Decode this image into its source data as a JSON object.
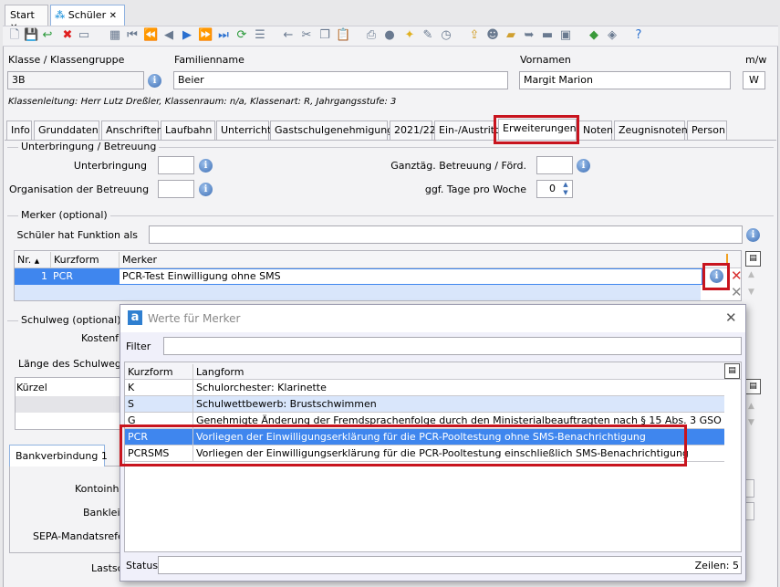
{
  "doc_tabs": [
    {
      "label": "Start",
      "close": "✕"
    },
    {
      "label": "Schüler",
      "close": "✕"
    }
  ],
  "toolbar": {
    "icons": [
      "new-icon",
      "save-icon",
      "undo-icon",
      "delete-icon",
      "remove-icon",
      "table-icon",
      "first-icon",
      "prev-page-icon",
      "prev-icon",
      "next-icon",
      "next-page-icon",
      "last-icon",
      "refresh-icon",
      "list-icon",
      "back-icon",
      "cut-icon",
      "copy-icon",
      "paste-icon",
      "print-icon",
      "disc-icon",
      "bulb-icon",
      "edit-icon",
      "clock-icon",
      "export-icon",
      "person-icon",
      "folder-icon",
      "folder-arrow-icon",
      "chat-icon",
      "id-card-icon",
      "tool-icon",
      "tool2-icon",
      "help-icon"
    ]
  },
  "header": {
    "klasse_label": "Klasse / Klassengruppe",
    "klasse_value": "3B",
    "familienname_label": "Familienname",
    "familienname_value": "Beier",
    "vornamen_label": "Vornamen",
    "vornamen_value": "Margit Marion",
    "mw_label": "m/w",
    "mw_value": "W",
    "info_line": "Klassenleitung: Herr Lutz Dreßler, Klassenraum: n/a, Klassenart: R, Jahrgangsstufe: 3"
  },
  "tabs": [
    "Info",
    "Grunddaten",
    "Anschriften",
    "Laufbahn",
    "Unterricht",
    "Gastschulgenehmigung",
    "2021/22",
    "Ein-/Austritt",
    "Erweiterungen",
    "Noten",
    "Zeugnisnoten",
    "Person"
  ],
  "active_tab": "Erweiterungen",
  "unterbringung": {
    "title": "Unterbringung / Betreuung",
    "unterbringung_label": "Unterbringung",
    "unterbringung_value": "",
    "organisation_label": "Organisation der Betreuung",
    "organisation_value": "",
    "ganztag_label": "Ganztäg. Betreuung / Förd.",
    "ganztag_value": "",
    "tage_label": "ggf. Tage pro Woche",
    "tage_value": "0"
  },
  "merker": {
    "title": "Merker (optional)",
    "funktion_label": "Schüler hat Funktion als",
    "funktion_value": "",
    "columns": [
      "Nr.",
      "Kurzform",
      "Merker"
    ],
    "rows": [
      {
        "nr": "1",
        "kurzform": "PCR",
        "merker": "PCR-Test Einwilligung ohne SMS"
      }
    ]
  },
  "schulweg": {
    "title": "Schulweg (optional)",
    "kosten_label": "Kostenfr",
    "laenge_label": "Länge des Schulwegs",
    "kuerzel_header": "Kürzel"
  },
  "bank": {
    "tab": "Bankverbindung 1",
    "kontoinhaber_label": "Kontoinha",
    "bankleitzahl_label": "Bankleit",
    "sepa_label": "SEPA-Mandatsrefer",
    "lastschrift_label": "Lastsc"
  },
  "dialog": {
    "title": "Werte für Merker",
    "filter_label": "Filter",
    "filter_value": "",
    "columns": [
      "Kurzform",
      "Langform"
    ],
    "rows": [
      {
        "kurz": "K",
        "lang": "Schulorchester: Klarinette"
      },
      {
        "kurz": "S",
        "lang": "Schulwettbewerb: Brustschwimmen"
      },
      {
        "kurz": "G",
        "lang": "Genehmigte Änderung der Fremdsprachenfolge durch den Ministerialbeauftragten nach § 15 Abs. 3 GSO"
      },
      {
        "kurz": "PCR",
        "lang": "Vorliegen der Einwilligungserklärung für die PCR-Pooltestung ohne SMS-Benachrichtigung"
      },
      {
        "kurz": "PCRSMS",
        "lang": "Vorliegen der Einwilligungserklärung für die PCR-Pooltestung einschließlich SMS-Benachrichtigung"
      }
    ],
    "selected_row": "PCR",
    "status_label": "Status",
    "status_value": "",
    "rows_count": "Zeilen: 5"
  },
  "colors": {
    "selection": "#3f86ee",
    "light_row": "#d9e6fb",
    "highlight": "#c8141e"
  }
}
